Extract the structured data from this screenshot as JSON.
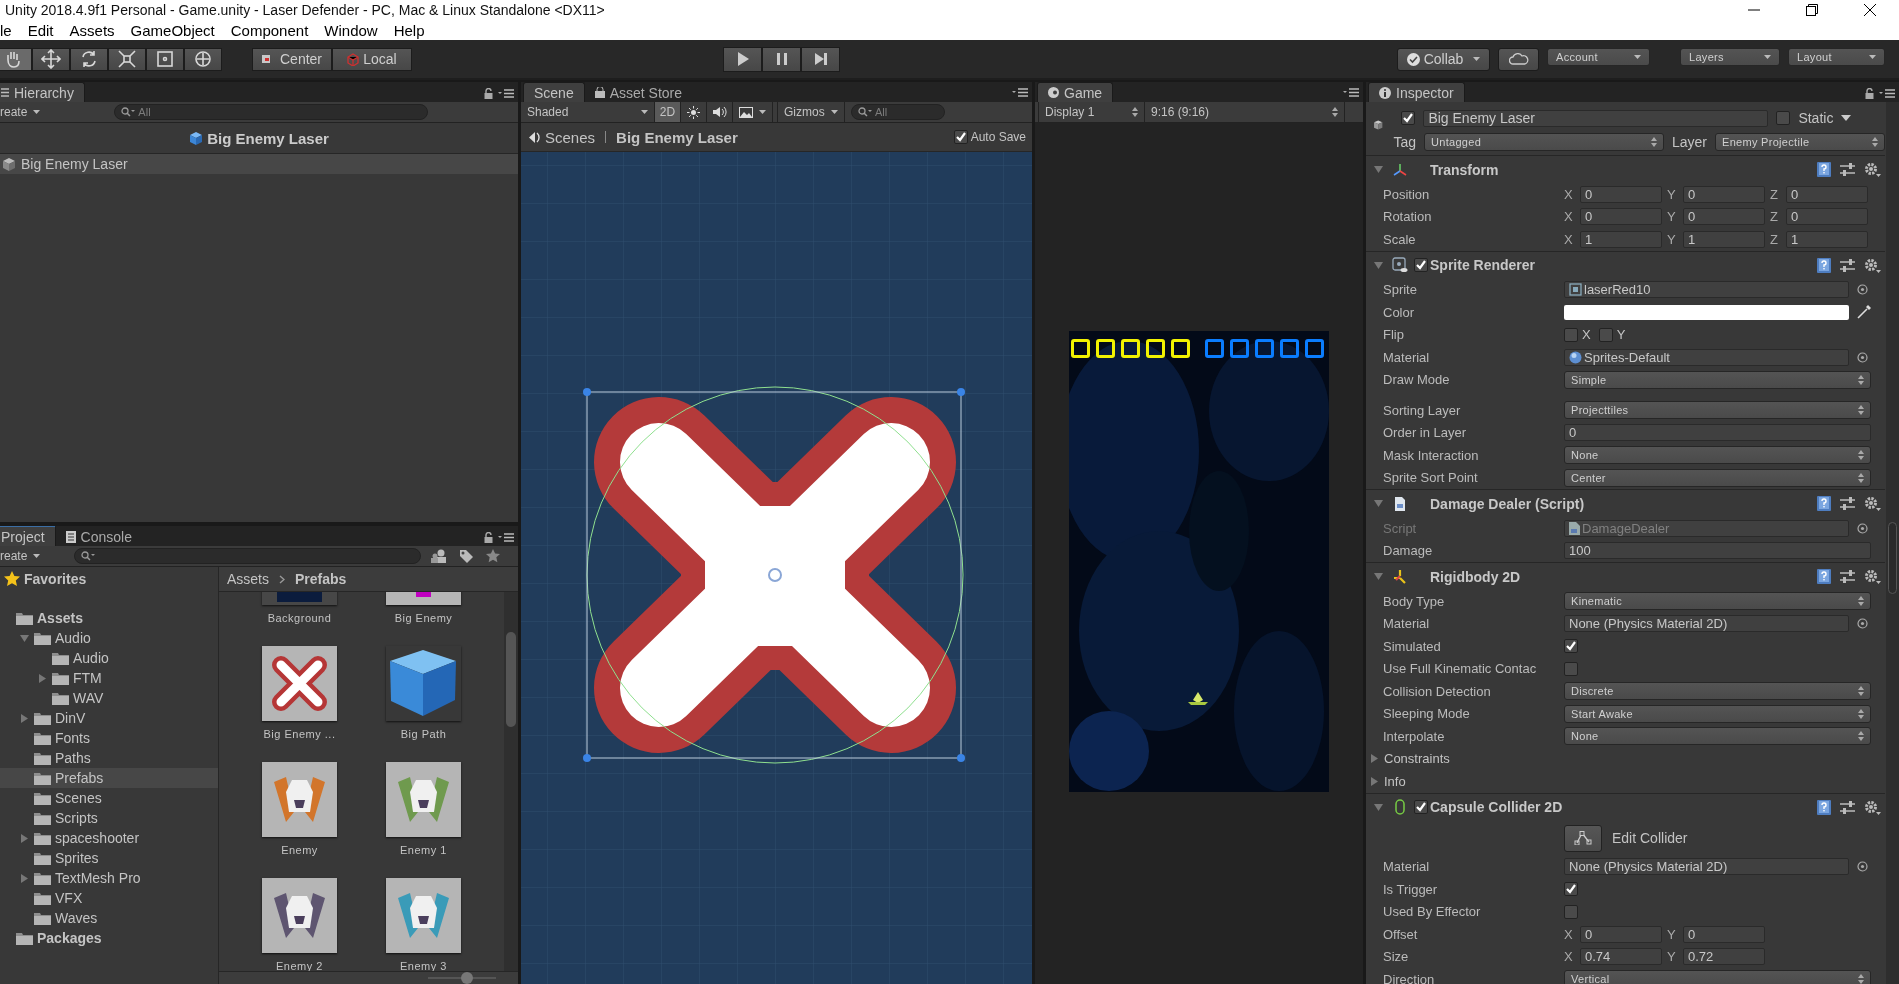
{
  "title_bar": {
    "title": "Unity 2018.4.9f1 Personal - Game.unity - Laser Defender - PC, Mac & Linux Standalone <DX11>"
  },
  "menu": [
    "le",
    "Edit",
    "Assets",
    "GameObject",
    "Component",
    "Window",
    "Help"
  ],
  "toolbar": {
    "tools": [
      {
        "kind": "hand",
        "selected": true
      },
      {
        "kind": "move",
        "selected": false
      },
      {
        "kind": "rotate",
        "selected": false
      },
      {
        "kind": "scale",
        "selected": false
      },
      {
        "kind": "rect",
        "selected": false
      },
      {
        "kind": "transform",
        "selected": false
      }
    ],
    "pivot": [
      {
        "kind": "pivot",
        "label": "Center"
      },
      {
        "kind": "space",
        "label": "Local"
      }
    ],
    "playback": [
      {
        "kind": "play"
      },
      {
        "kind": "pause"
      },
      {
        "kind": "step"
      }
    ],
    "right": [
      {
        "kind": "collab",
        "label": "Collab"
      },
      {
        "kind": "cloud"
      },
      {
        "kind": "dropdown",
        "label": "Account"
      },
      {
        "kind": "dropdown",
        "label": "Layers"
      },
      {
        "kind": "dropdown",
        "label": "Layout"
      }
    ]
  },
  "hierarchy": {
    "tab": "Hierarchy",
    "create": "reate",
    "search": {
      "placeholder": "All"
    },
    "scene_header": "Big Enemy Laser",
    "items": [
      {
        "label": "Big Enemy Laser",
        "selected": true
      }
    ]
  },
  "scene": {
    "tabs": [
      {
        "label": "Scene",
        "selected": true,
        "kind": "scene"
      },
      {
        "label": "Asset Store",
        "selected": false,
        "kind": "store"
      }
    ],
    "shading": "Shaded",
    "mode_2d": {
      "label": "2D",
      "on": true
    },
    "gizmos": "Gizmos",
    "search": {
      "placeholder": "All"
    },
    "breadcrumb": [
      "Scenes",
      "Big Enemy Laser"
    ],
    "auto_save": {
      "label": "Auto Save",
      "checked": true
    }
  },
  "game": {
    "tab": "Game",
    "display": "Display 1",
    "aspect": "9:16 (9:16)",
    "hud": [
      {
        "color": "#f2f200"
      },
      {
        "color": "#f2f200"
      },
      {
        "color": "#f2f200"
      },
      {
        "color": "#f2f200"
      },
      {
        "color": "#f2f200"
      },
      {
        "color": "#0a7dff"
      },
      {
        "color": "#0a7dff"
      },
      {
        "color": "#0a7dff"
      },
      {
        "color": "#0a7dff"
      },
      {
        "color": "#0a7dff"
      }
    ]
  },
  "inspector": {
    "tab": "Inspector",
    "object": {
      "active": true,
      "name": "Big Enemy Laser",
      "static": {
        "label": "Static",
        "checked": false
      },
      "tag_label": "Tag",
      "tag": "Untagged",
      "layer_label": "Layer",
      "layer": "Enemy Projectile"
    },
    "components": [
      {
        "kind": "transform",
        "title": "Transform",
        "expanded": true,
        "rows": [
          {
            "kind": "vector",
            "label": "Position",
            "axes": [
              {
                "axis": "X",
                "value": "0"
              },
              {
                "axis": "Y",
                "value": "0"
              },
              {
                "axis": "Z",
                "value": "0"
              }
            ]
          },
          {
            "kind": "vector",
            "label": "Rotation",
            "axes": [
              {
                "axis": "X",
                "value": "0"
              },
              {
                "axis": "Y",
                "value": "0"
              },
              {
                "axis": "Z",
                "value": "0"
              }
            ]
          },
          {
            "kind": "vector",
            "label": "Scale",
            "axes": [
              {
                "axis": "X",
                "value": "1"
              },
              {
                "axis": "Y",
                "value": "1"
              },
              {
                "axis": "Z",
                "value": "1"
              }
            ]
          }
        ]
      },
      {
        "kind": "sprite_renderer",
        "title": "Sprite Renderer",
        "expanded": true,
        "enabled": true,
        "rows": [
          {
            "kind": "sprite_ref",
            "label": "Sprite",
            "value": "laserRed10"
          },
          {
            "kind": "color",
            "label": "Color",
            "color": "#ffffff"
          },
          {
            "kind": "flip",
            "label": "Flip",
            "checks": [
              {
                "label": "X",
                "checked": false
              },
              {
                "label": "Y",
                "checked": false
              }
            ]
          },
          {
            "kind": "material_ref",
            "label": "Material",
            "value": "Sprites-Default"
          },
          {
            "kind": "dropdown",
            "label": "Draw Mode",
            "value": "Simple"
          },
          {
            "kind": "dropdown",
            "label": "Sorting Layer",
            "value": "Projecttiles",
            "gap_before": true
          },
          {
            "kind": "number",
            "label": "Order in Layer",
            "value": "0"
          },
          {
            "kind": "dropdown",
            "label": "Mask Interaction",
            "value": "None"
          },
          {
            "kind": "dropdown",
            "label": "Sprite Sort Point",
            "value": "Center"
          }
        ]
      },
      {
        "kind": "script",
        "title": "Damage Dealer (Script)",
        "expanded": true,
        "rows": [
          {
            "kind": "script_ref",
            "label": "Script",
            "value": "DamageDealer",
            "disabled": true
          },
          {
            "kind": "number",
            "label": "Damage",
            "value": "100"
          }
        ]
      },
      {
        "kind": "rigidbody",
        "title": "Rigidbody 2D",
        "expanded": true,
        "rows": [
          {
            "kind": "dropdown",
            "label": "Body Type",
            "value": "Kinematic"
          },
          {
            "kind": "object",
            "label": "Material",
            "value": "None (Physics Material 2D)"
          },
          {
            "kind": "checkbox",
            "label": "Simulated",
            "checked": true
          },
          {
            "kind": "checkbox",
            "label": "Use Full Kinematic Contac",
            "checked": false
          },
          {
            "kind": "dropdown",
            "label": "Collision Detection",
            "value": "Discrete"
          },
          {
            "kind": "dropdown",
            "label": "Sleeping Mode",
            "value": "Start Awake"
          },
          {
            "kind": "dropdown",
            "label": "Interpolate",
            "value": "None"
          },
          {
            "kind": "foldout",
            "label": "Constraints",
            "expanded": false
          },
          {
            "kind": "foldout",
            "label": "Info",
            "expanded": false
          }
        ]
      },
      {
        "kind": "capsule",
        "title": "Capsule Collider 2D",
        "expanded": true,
        "enabled": true,
        "rows": [
          {
            "kind": "button",
            "label": "Edit Collider"
          },
          {
            "kind": "object",
            "label": "Material",
            "value": "None (Physics Material 2D)"
          },
          {
            "kind": "checkbox",
            "label": "Is Trigger",
            "checked": true
          },
          {
            "kind": "checkbox",
            "label": "Used By Effector",
            "checked": false
          },
          {
            "kind": "vector",
            "label": "Offset",
            "axes": [
              {
                "axis": "X",
                "value": "0"
              },
              {
                "axis": "Y",
                "value": "0"
              }
            ]
          },
          {
            "kind": "vector",
            "label": "Size",
            "axes": [
              {
                "axis": "X",
                "value": "0.74"
              },
              {
                "axis": "Y",
                "value": "0.72"
              }
            ]
          },
          {
            "kind": "dropdown",
            "label": "Direction",
            "value": "Vertical"
          }
        ]
      }
    ]
  },
  "project": {
    "tabs": [
      {
        "label": "Project",
        "selected": true,
        "kind": "project"
      },
      {
        "label": "Console",
        "selected": false,
        "kind": "console"
      }
    ],
    "create": "reate",
    "tree": [
      {
        "kind": "favorites",
        "label": "Favorites",
        "selected": false
      },
      {
        "kind": "root",
        "label": "Assets",
        "selected": false,
        "children": [
          {
            "kind": "folder",
            "label": "Audio",
            "selected": false,
            "expanded": true,
            "children": [
              {
                "kind": "folder",
                "label": "Audio",
                "selected": false
              },
              {
                "kind": "folder",
                "label": "FTM",
                "selected": false,
                "expanded": false
              },
              {
                "kind": "folder",
                "label": "WAV",
                "selected": false
              }
            ]
          },
          {
            "kind": "folder",
            "label": "DinV",
            "selected": false,
            "expanded": false
          },
          {
            "kind": "folder",
            "label": "Fonts",
            "selected": false
          },
          {
            "kind": "folder",
            "label": "Paths",
            "selected": false
          },
          {
            "kind": "folder",
            "label": "Prefabs",
            "selected": true
          },
          {
            "kind": "folder",
            "label": "Scenes",
            "selected": false
          },
          {
            "kind": "folder",
            "label": "Scripts",
            "selected": false
          },
          {
            "kind": "folder",
            "label": "spaceshooter",
            "selected": false,
            "expanded": false
          },
          {
            "kind": "folder",
            "label": "Sprites",
            "selected": false
          },
          {
            "kind": "folder",
            "label": "TextMesh Pro",
            "selected": false,
            "expanded": false
          },
          {
            "kind": "folder",
            "label": "VFX",
            "selected": false
          },
          {
            "kind": "folder",
            "label": "Waves",
            "selected": false
          }
        ]
      },
      {
        "kind": "root",
        "label": "Packages",
        "selected": false
      }
    ],
    "breadcrumb": [
      "Assets",
      "Prefabs"
    ],
    "assets": [
      {
        "label": "Background",
        "kind": "space"
      },
      {
        "label": "Big Enemy",
        "kind": "sprite"
      },
      {
        "label": "Big Enemy ...",
        "kind": "cross"
      },
      {
        "label": "Big Path",
        "kind": "cube"
      },
      {
        "label": "Enemy",
        "kind": "ship",
        "color": "#d2752b"
      },
      {
        "label": "Enemy 1",
        "kind": "ship",
        "color": "#6f9a4e"
      },
      {
        "label": "Enemy 2",
        "kind": "ship",
        "color": "#5e5570"
      },
      {
        "label": "Enemy 3",
        "kind": "ship",
        "color": "#3a9bb8"
      }
    ],
    "icon_size": {
      "level": 0.58
    }
  }
}
